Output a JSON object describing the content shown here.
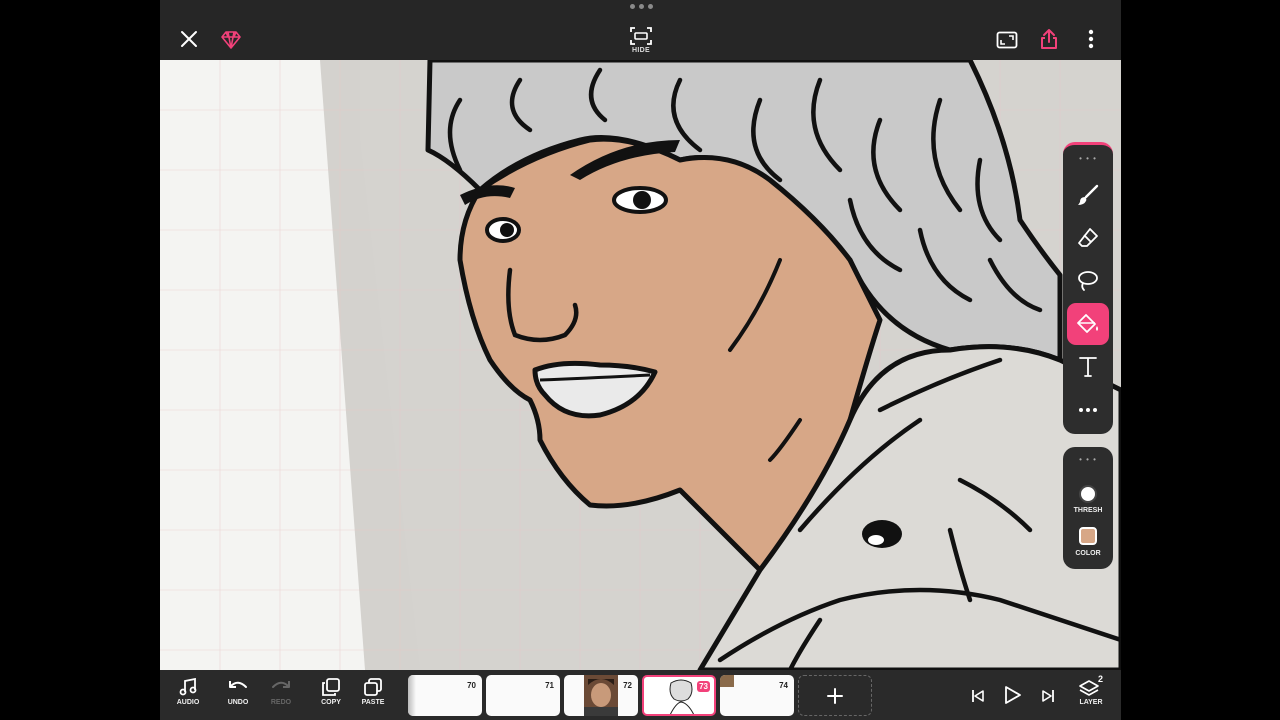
{
  "topbar": {
    "hide_label": "HIDE",
    "icons": [
      "close-icon",
      "gem-icon",
      "hide-ui-icon",
      "aspect-ratio-icon",
      "share-icon",
      "more-vertical-icon"
    ],
    "accent_color": "#f2417a"
  },
  "tools": {
    "items": [
      {
        "name": "brush",
        "icon": "brush-icon"
      },
      {
        "name": "eraser",
        "icon": "eraser-icon"
      },
      {
        "name": "lasso",
        "icon": "lasso-icon"
      },
      {
        "name": "fill",
        "icon": "paint-bucket-icon",
        "active": true
      },
      {
        "name": "text",
        "icon": "text-icon"
      },
      {
        "name": "more",
        "icon": "more-horizontal-icon"
      }
    ],
    "thresh_label": "THRESH",
    "color_label": "COLOR",
    "current_color": "#d7a787"
  },
  "bottombar": {
    "audio_label": "AUDIO",
    "undo_label": "UNDO",
    "redo_label": "REDO",
    "copy_label": "COPY",
    "paste_label": "PASTE",
    "layer_label": "LAYER",
    "layer_count": "2",
    "frames": [
      {
        "number": "70"
      },
      {
        "number": "71"
      },
      {
        "number": "72"
      },
      {
        "number": "73",
        "active": true
      },
      {
        "number": "74"
      }
    ]
  }
}
